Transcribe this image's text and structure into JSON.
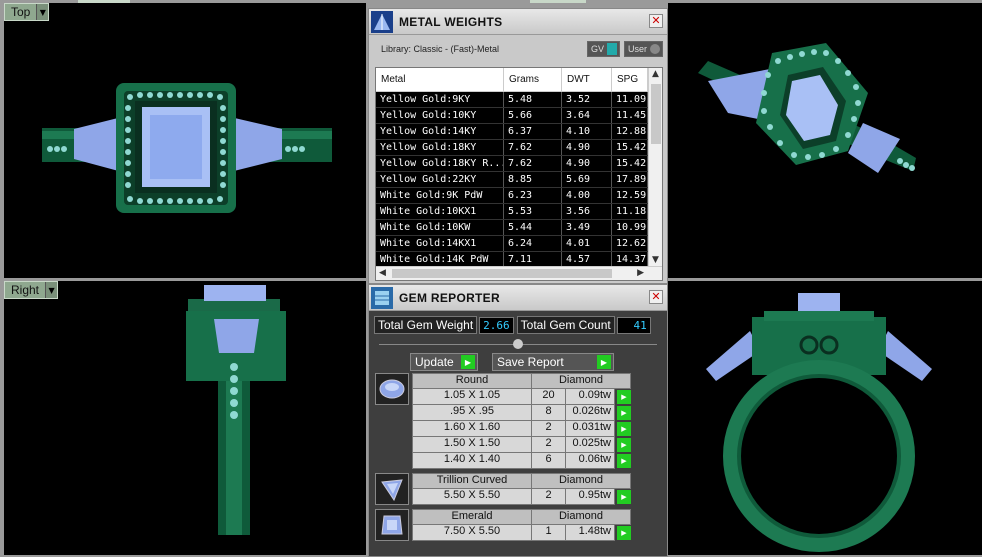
{
  "viewports": {
    "top": {
      "label": "Top"
    },
    "right": {
      "label": "Right"
    }
  },
  "metal_weights": {
    "title": "METAL WEIGHTS",
    "library": "Library: Classic - (Fast)-Metal",
    "toggle": {
      "gv": "GV",
      "user": "User"
    },
    "columns": [
      "Metal",
      "Grams",
      "DWT",
      "SPG"
    ],
    "rows": [
      {
        "metal": "Yellow Gold:9KY",
        "grams": "5.48",
        "dwt": "3.52",
        "spg": "11.09"
      },
      {
        "metal": "Yellow Gold:10KY",
        "grams": "5.66",
        "dwt": "3.64",
        "spg": "11.45"
      },
      {
        "metal": "Yellow Gold:14KY",
        "grams": "6.37",
        "dwt": "4.10",
        "spg": "12.88"
      },
      {
        "metal": "Yellow Gold:18KY",
        "grams": "7.62",
        "dwt": "4.90",
        "spg": "15.42"
      },
      {
        "metal": "Yellow Gold:18KY R...",
        "grams": "7.62",
        "dwt": "4.90",
        "spg": "15.42"
      },
      {
        "metal": "Yellow Gold:22KY",
        "grams": "8.85",
        "dwt": "5.69",
        "spg": "17.89"
      },
      {
        "metal": "White Gold:9K PdW",
        "grams": "6.23",
        "dwt": "4.00",
        "spg": "12.59"
      },
      {
        "metal": "White Gold:10KX1",
        "grams": "5.53",
        "dwt": "3.56",
        "spg": "11.18"
      },
      {
        "metal": "White Gold:10KW",
        "grams": "5.44",
        "dwt": "3.49",
        "spg": "10.99"
      },
      {
        "metal": "White Gold:14KX1",
        "grams": "6.24",
        "dwt": "4.01",
        "spg": "12.62"
      },
      {
        "metal": "White Gold:14K PdW",
        "grams": "7.11",
        "dwt": "4.57",
        "spg": "14.37"
      }
    ]
  },
  "gem_reporter": {
    "title": "GEM REPORTER",
    "total_weight_label": "Total Gem Weight",
    "total_weight": "2.66",
    "total_count_label": "Total Gem Count",
    "total_count": "41",
    "update_label": "Update",
    "save_report_label": "Save Report",
    "groups": [
      {
        "shape": "Round",
        "material": "Diamond",
        "icon": "round-gem-icon",
        "rows": [
          {
            "size": "1.05 X 1.05",
            "count": "20",
            "tw": "0.09tw"
          },
          {
            "size": ".95 X .95",
            "count": "8",
            "tw": "0.026tw"
          },
          {
            "size": "1.60 X 1.60",
            "count": "2",
            "tw": "0.031tw"
          },
          {
            "size": "1.50 X 1.50",
            "count": "2",
            "tw": "0.025tw"
          },
          {
            "size": "1.40 X 1.40",
            "count": "6",
            "tw": "0.06tw"
          }
        ]
      },
      {
        "shape": "Trillion Curved",
        "material": "Diamond",
        "icon": "trillion-gem-icon",
        "rows": [
          {
            "size": "5.50 X 5.50",
            "count": "2",
            "tw": "0.95tw"
          }
        ]
      },
      {
        "shape": "Emerald",
        "material": "Diamond",
        "icon": "emerald-gem-icon",
        "rows": [
          {
            "size": "7.50 X 5.50",
            "count": "1",
            "tw": "1.48tw"
          }
        ]
      }
    ]
  }
}
